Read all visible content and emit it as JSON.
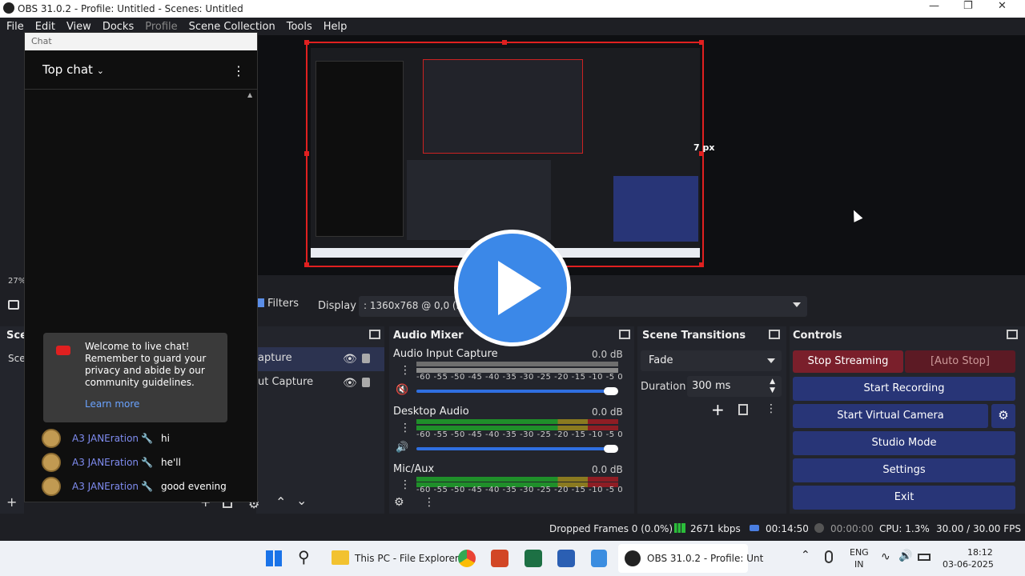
{
  "window": {
    "title": "OBS 31.0.2 - Profile: Untitled - Scenes: Untitled"
  },
  "menu": [
    "File",
    "Edit",
    "View",
    "Docks",
    "Profile",
    "Scene Collection",
    "Tools",
    "Help"
  ],
  "preview": {
    "zoom": "27%",
    "size_hint": "7 px"
  },
  "toolbar": {
    "filters_label": "Filters",
    "display_label": "Display",
    "display_value": ": 1360x768 @ 0,0 (Pri"
  },
  "scenes": {
    "title": "Scen",
    "item": "Scen"
  },
  "sources": {
    "items": [
      "apture",
      "ut Capture"
    ]
  },
  "mixer": {
    "title": "Audio Mixer",
    "channels": [
      {
        "name": "Audio Input Capture",
        "db": "0.0 dB"
      },
      {
        "name": "Desktop Audio",
        "db": "0.0 dB"
      },
      {
        "name": "Mic/Aux",
        "db": "0.0 dB"
      }
    ],
    "ticks": "-60 -55 -50 -45 -40 -35 -30 -25 -20 -15 -10 -5  0"
  },
  "transitions": {
    "title": "Scene Transitions",
    "selected": "Fade",
    "duration_label": "Duration",
    "duration_value": "300 ms"
  },
  "controls": {
    "title": "Controls",
    "stop_streaming": "Stop Streaming",
    "auto_stop": "[Auto Stop]",
    "start_recording": "Start Recording",
    "start_virtual_camera": "Start Virtual Camera",
    "studio_mode": "Studio Mode",
    "settings": "Settings",
    "exit": "Exit"
  },
  "status": {
    "dropped_frames": "Dropped Frames 0 (0.0%)",
    "bitrate": "2671 kbps",
    "stream_time": "00:14:50",
    "rec_time": "00:00:00",
    "cpu": "CPU: 1.3%",
    "fps": "30.00 / 30.00 FPS"
  },
  "chat": {
    "window_title": "Chat",
    "header": "Top chat",
    "welcome": "Welcome to live chat! Remember to guard your privacy and abide by our community guidelines.",
    "learn_more": "Learn more",
    "messages": [
      {
        "author": "A3 JANEration",
        "text": "hi"
      },
      {
        "author": "A3 JANEration",
        "text": "he'll"
      },
      {
        "author": "A3 JANEration",
        "text": "good evening"
      }
    ]
  },
  "taskbar": {
    "explorer_label": "This PC - File Explorer",
    "obs_label": "OBS 31.0.2 - Profile: Unt",
    "lang_top": "ENG",
    "lang_bottom": "IN",
    "time": "18:12",
    "date": "03-06-2025"
  },
  "colors": {
    "accent": "#283577",
    "stop": "#7a1f2b",
    "canvas_border": "#e02020",
    "play": "#3b88e8"
  }
}
